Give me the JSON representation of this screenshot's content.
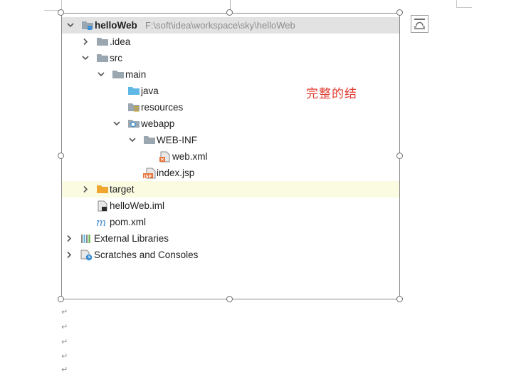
{
  "tree": {
    "root": {
      "label": "helloWeb",
      "path": "F:\\soft\\idea\\workspace\\sky\\helloWeb"
    },
    "items": [
      {
        "label": ".idea"
      },
      {
        "label": "src"
      },
      {
        "label": "main"
      },
      {
        "label": "java"
      },
      {
        "label": "resources"
      },
      {
        "label": "webapp"
      },
      {
        "label": "WEB-INF"
      },
      {
        "label": "web.xml"
      },
      {
        "label": "index.jsp"
      },
      {
        "label": "target"
      },
      {
        "label": "helloWeb.iml"
      },
      {
        "label": "pom.xml"
      },
      {
        "label": "External Libraries"
      },
      {
        "label": "Scratches and Consoles"
      }
    ]
  },
  "annotation": {
    "text": "完整的结"
  },
  "document": {
    "paragraph_mark": "↵"
  },
  "colors": {
    "selection": "#e2e2e2",
    "target_highlight": "#fbfbe2",
    "annotation": "#e03a2e",
    "folder": "#9aa7b0",
    "source_folder": "#5fb7e5",
    "excluded_folder": "#f0a732"
  },
  "icons": {
    "folder": "folder-icon",
    "module": "module-folder-icon",
    "source_root": "source-root-icon",
    "resources_root": "resources-root-icon",
    "web_root": "web-root-icon",
    "excluded": "excluded-folder-icon",
    "xml": "xml-file-icon",
    "jsp": "jsp-file-icon",
    "iml": "iml-file-icon",
    "maven": "maven-icon",
    "libraries": "libraries-icon",
    "scratches": "scratches-icon"
  }
}
